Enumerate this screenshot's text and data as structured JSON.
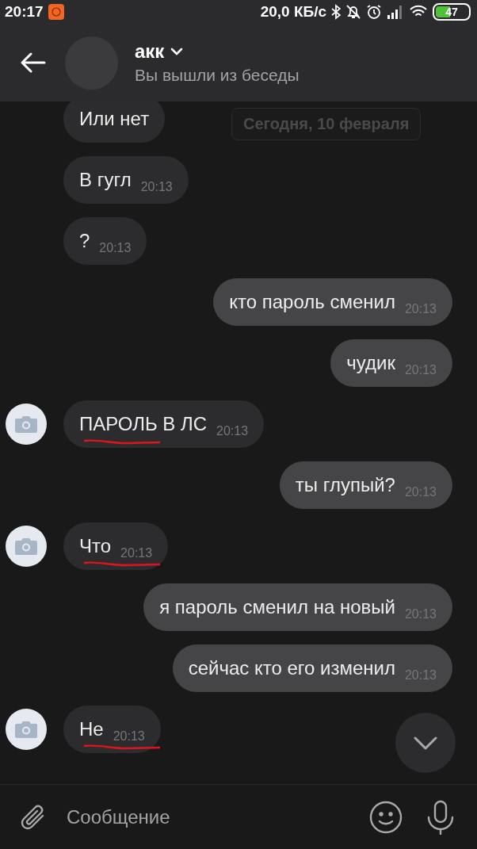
{
  "status_bar": {
    "time": "20:17",
    "speed": "20,0 КБ/с",
    "battery": "47"
  },
  "header": {
    "name": "акк",
    "subtitle": "Вы вышли из беседы"
  },
  "date_divider": "Сегодня, 10 февраля",
  "messages": [
    {
      "kind": "incoming",
      "text": "Или нет",
      "avatar": false,
      "underlined": false
    },
    {
      "kind": "incoming",
      "text": "В гугл",
      "time": "20:13",
      "avatar": false,
      "underlined": false
    },
    {
      "kind": "incoming",
      "text": "?",
      "time": "20:13",
      "avatar": false,
      "underlined": false
    },
    {
      "kind": "outgoing",
      "text": "кто пароль сменил",
      "time": "20:13",
      "avatar": false,
      "underlined": false
    },
    {
      "kind": "outgoing",
      "text": "чудик",
      "time": "20:13",
      "avatar": false,
      "underlined": false
    },
    {
      "kind": "incoming",
      "text": "ПАРОЛЬ В ЛС",
      "time": "20:13",
      "avatar": true,
      "underlined": true
    },
    {
      "kind": "outgoing",
      "text": "ты глупый?",
      "time": "20:13",
      "avatar": false,
      "underlined": false
    },
    {
      "kind": "incoming",
      "text": "Что",
      "time": "20:13",
      "avatar": true,
      "underlined": true
    },
    {
      "kind": "outgoing",
      "text": "я пароль сменил на новый",
      "time": "20:13",
      "avatar": false,
      "underlined": false
    },
    {
      "kind": "outgoing",
      "text": "сейчас кто его изменил",
      "time": "20:13",
      "avatar": false,
      "underlined": false
    },
    {
      "kind": "incoming",
      "text": "Не",
      "time": "20:13",
      "avatar": true,
      "underlined": true
    }
  ],
  "composer": {
    "placeholder": "Сообщение"
  }
}
